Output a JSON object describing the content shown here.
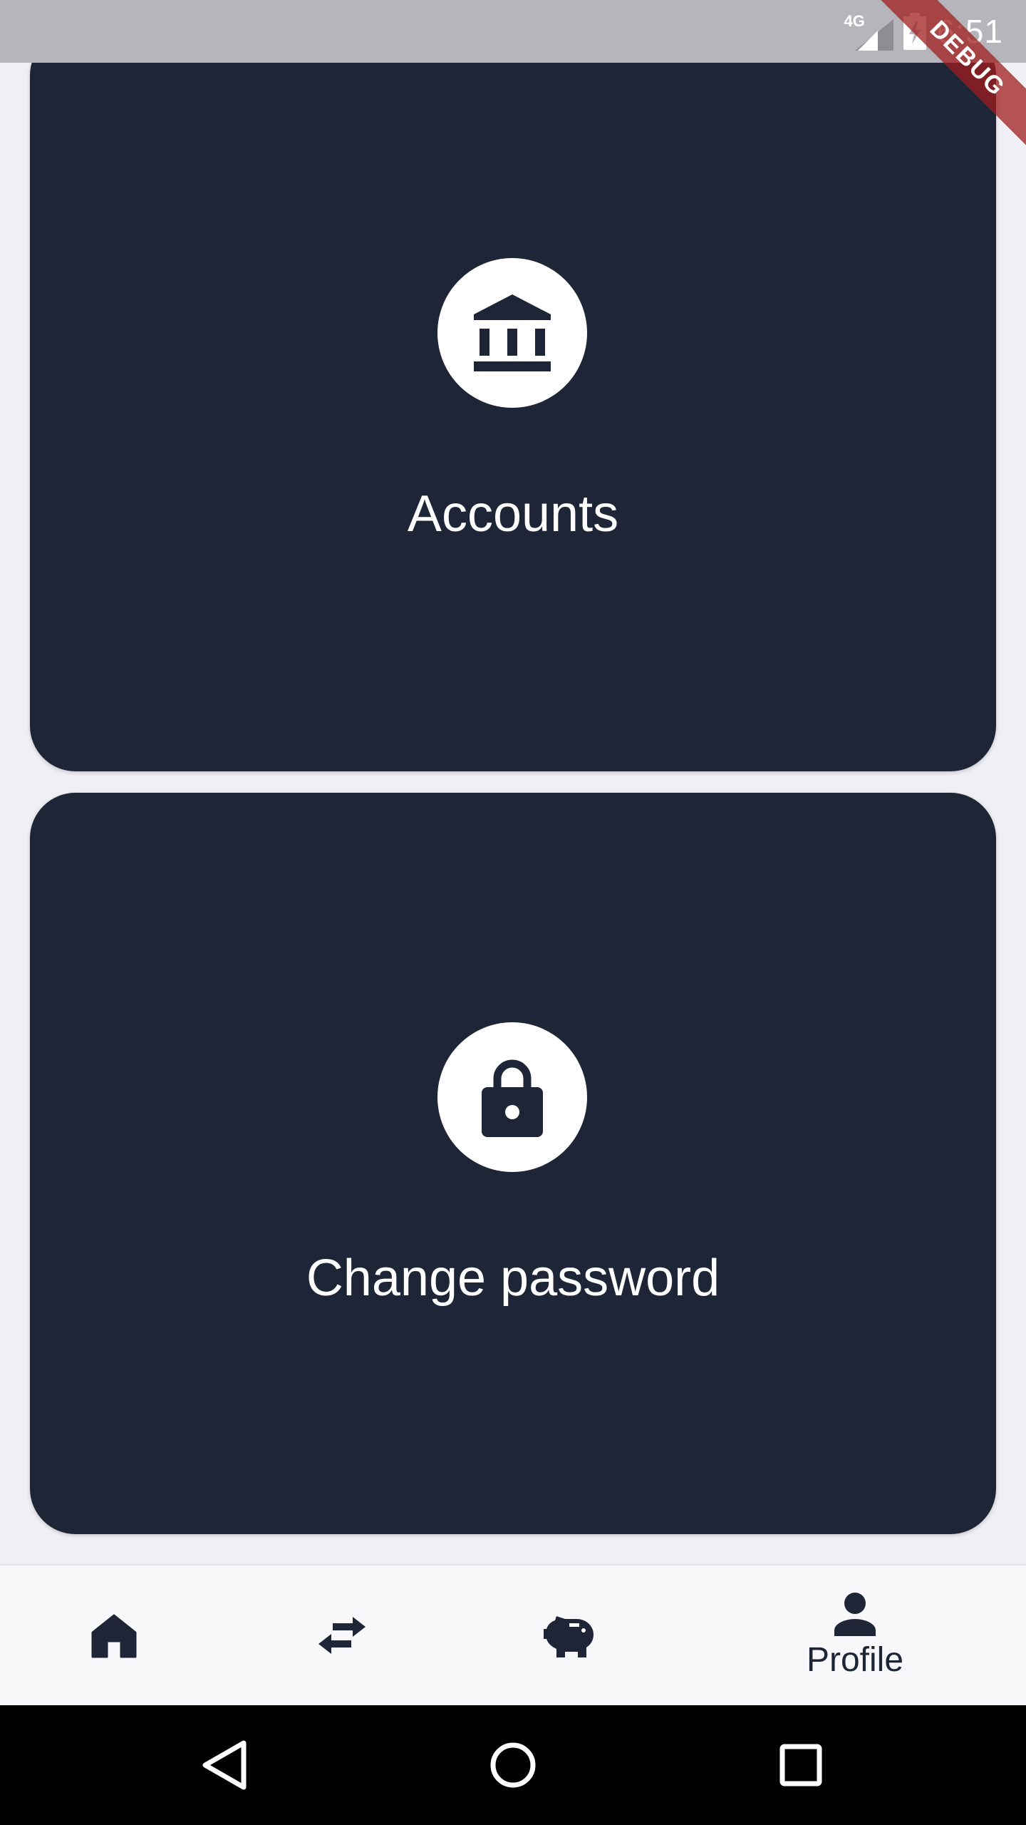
{
  "status_bar": {
    "network_label": "4G",
    "time": "6:51",
    "debug_label": "DEBUG"
  },
  "cards": [
    {
      "label": "Accounts",
      "icon": "bank-icon"
    },
    {
      "label": "Change password",
      "icon": "lock-icon"
    }
  ],
  "bottom_nav": {
    "items": [
      {
        "icon": "home-icon",
        "label": ""
      },
      {
        "icon": "swap-arrows-icon",
        "label": ""
      },
      {
        "icon": "piggy-bank-icon",
        "label": ""
      },
      {
        "icon": "person-icon",
        "label": "Profile",
        "selected": true
      }
    ]
  },
  "system_nav": {
    "buttons": [
      "back-icon",
      "home-circle-icon",
      "recent-apps-icon"
    ]
  },
  "colors": {
    "card_background": "#1e2536",
    "page_background": "#f0eff5",
    "status_bar": "#b6b5bb",
    "debug_banner": "#a01e1e",
    "nav_background": "#f8f8fa",
    "icon_dark": "#1e2536"
  }
}
